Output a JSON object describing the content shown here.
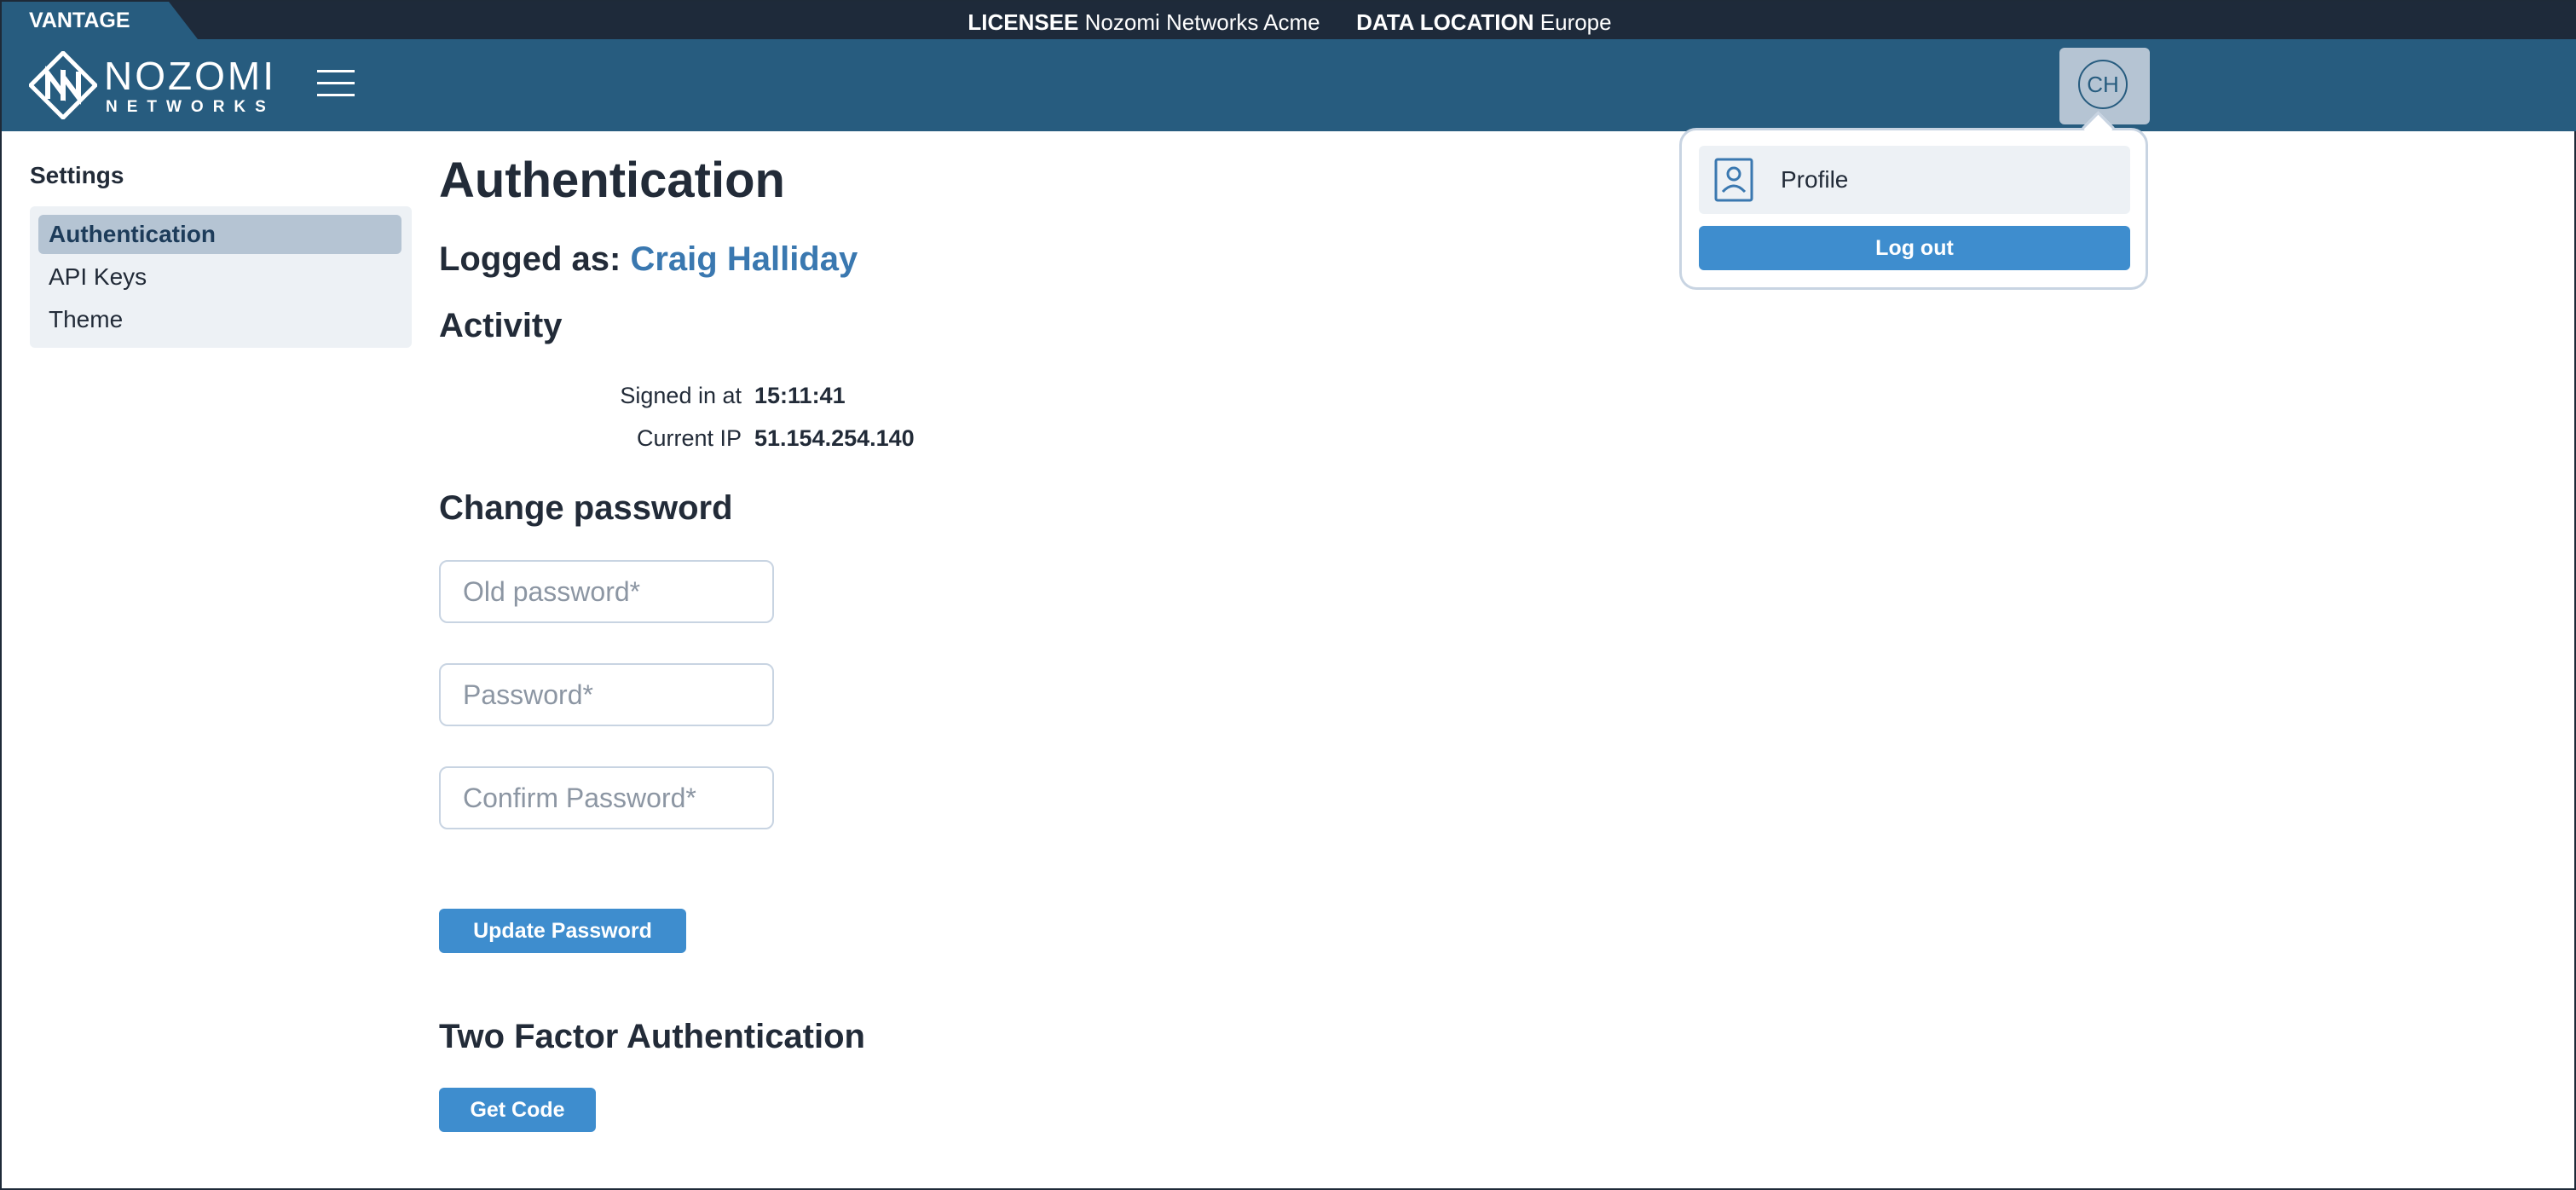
{
  "top_bar": {
    "product": "VANTAGE",
    "licensee_label": "LICENSEE",
    "licensee_value": "Nozomi Networks Acme",
    "location_label": "DATA LOCATION",
    "location_value": "Europe"
  },
  "header": {
    "logo_word": "NOZOMI",
    "logo_sub": "NETWORKS",
    "avatar_initials": "CH"
  },
  "user_menu": {
    "profile_label": "Profile",
    "logout_label": "Log out"
  },
  "sidebar": {
    "title": "Settings",
    "items": [
      {
        "label": "Authentication",
        "active": true
      },
      {
        "label": "API Keys",
        "active": false
      },
      {
        "label": "Theme",
        "active": false
      }
    ]
  },
  "main": {
    "title": "Authentication",
    "logged_as_label": "Logged as:",
    "user_name": "Craig Halliday",
    "activity": {
      "title": "Activity",
      "rows": [
        {
          "label": "Signed in at",
          "value": "15:11:41"
        },
        {
          "label": "Current IP",
          "value": "51.154.254.140"
        }
      ]
    },
    "change_password": {
      "title": "Change password",
      "old_placeholder": "Old password*",
      "new_placeholder": "Password*",
      "confirm_placeholder": "Confirm Password*",
      "old_value": "",
      "new_value": "",
      "confirm_value": "",
      "submit_label": "Update Password"
    },
    "two_factor": {
      "title": "Two Factor Authentication",
      "button_label": "Get Code"
    }
  },
  "colors": {
    "header_bg": "#275c7f",
    "top_strip_bg": "#1e2a3a",
    "accent_button": "#3e8dce",
    "user_link": "#3a78b0",
    "sidebar_bg": "#edf1f5",
    "sidebar_active": "#b5c4d3"
  },
  "icons": [
    "hamburger-menu-icon",
    "profile-icon",
    "nozomi-logo-mark"
  ]
}
